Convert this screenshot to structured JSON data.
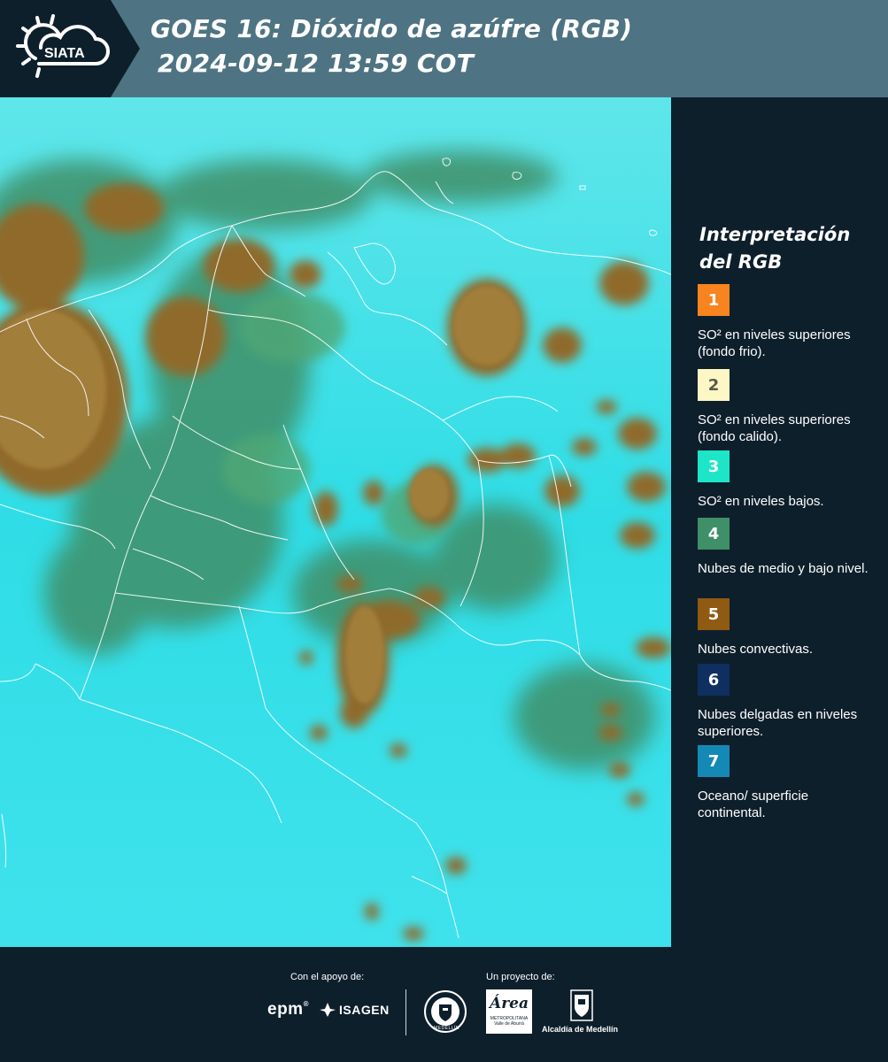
{
  "header": {
    "logo_text": "SIATA",
    "title_line1": "GOES 16: Dióxido de azúfre (RGB)",
    "title_line2": "2024-09-12 13:59 COT"
  },
  "legend": {
    "title_line1": "Interpretación",
    "title_line2": "del RGB",
    "items": [
      {
        "number": "1",
        "color": "#f7841e",
        "text_color": "#ffffff",
        "label": "SO² en niveles superiores (fondo frio)."
      },
      {
        "number": "2",
        "color": "#fdf7c5",
        "text_color": "#5a5a4a",
        "label": "SO² en niveles superiores (fondo calido)."
      },
      {
        "number": "3",
        "color": "#1de6c8",
        "text_color": "#ffffff",
        "label": "SO² en niveles bajos."
      },
      {
        "number": "4",
        "color": "#3f8f68",
        "text_color": "#ffffff",
        "label": "Nubes de medio y bajo nivel."
      },
      {
        "number": "5",
        "color": "#8f5a12",
        "text_color": "#ffffff",
        "label": "Nubes convectivas."
      },
      {
        "number": "6",
        "color": "#0e2f5f",
        "text_color": "#ffffff",
        "label": "Nubes delgadas en niveles superiores."
      },
      {
        "number": "7",
        "color": "#1589b6",
        "text_color": "#ffffff",
        "label": "Oceano/ superficie continental."
      }
    ]
  },
  "footer": {
    "support_label": "Con el apoyo de:",
    "project_label": "Un proyecto de:",
    "epm": "epm",
    "isagen": "ISAGEN",
    "medellin_seal": "MEDELLÍN",
    "area_brand": "Área",
    "area_sub1": "METROPOLITANA",
    "area_sub2": "Valle de Aburrá",
    "alcaldia": "Alcaldía de Medellín"
  },
  "colors": {
    "background": "#0e1f2c",
    "header_band": "#4e7483",
    "ocean_land": "#27d8e4",
    "convective": "#8f6b2a",
    "mid_low": "#3f8f68"
  }
}
